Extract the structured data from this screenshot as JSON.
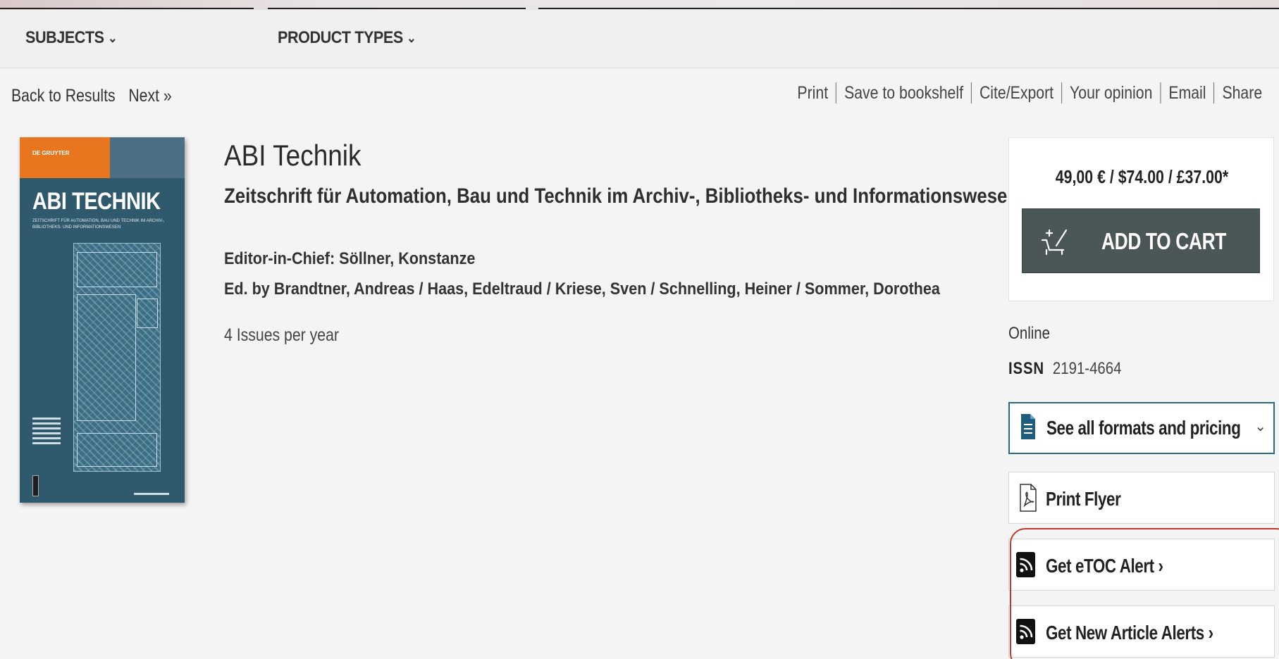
{
  "nav": {
    "subjects_label": "SUBJECTS",
    "product_types_label": "PRODUCT TYPES"
  },
  "breadcrumb": {
    "back_label": "Back to Results",
    "next_label": "Next »"
  },
  "toolbar": {
    "items": [
      "Print",
      "Save to bookshelf",
      "Cite/Export",
      "Your opinion",
      "Email",
      "Share"
    ]
  },
  "cover": {
    "publisher": "DE GRUYTER",
    "title": "ABI TECHNIK",
    "subtitle": "ZEITSCHRIFT FÜR AUTOMATION, BAU UND TECHNIK IM ARCHIV-, BIBLIOTHEKS- UND INFORMATIONSWESEN"
  },
  "journal": {
    "title": "ABI Technik",
    "subtitle": "Zeitschrift für Automation, Bau und Technik im Archiv-, Bibliotheks- und Informationswesen",
    "editor_in_chief": "Editor-in-Chief: Söllner, Konstanze",
    "edited_by": "Ed. by Brandtner, Andreas / Haas, Edeltraud / Kriese, Sven / Schnelling, Heiner / Sommer, Dorothea",
    "issues": "4 Issues per year"
  },
  "purchase": {
    "price": "49,00 € / $74.00 / £37.00*",
    "add_to_cart_label": "ADD TO CART",
    "format": "Online",
    "issn_label": "ISSN",
    "issn_value": "2191-4664"
  },
  "actions": {
    "formats_label": "See all formats and pricing",
    "flyer_label": "Print Flyer",
    "etoc_label": "Get eTOC Alert ›",
    "new_article_label": "Get New Article Alerts ›"
  },
  "icons": {
    "chevron": "chevron-down-icon",
    "cart": "cart-icon",
    "document": "document-icon",
    "pdf": "pdf-icon",
    "rss": "rss-icon"
  },
  "colors": {
    "cover_orange": "#e8761e",
    "cover_blue": "#2f5a6e",
    "cart_button": "#4b5656",
    "formats_border": "#2d6784",
    "highlight": "#c0392b"
  }
}
